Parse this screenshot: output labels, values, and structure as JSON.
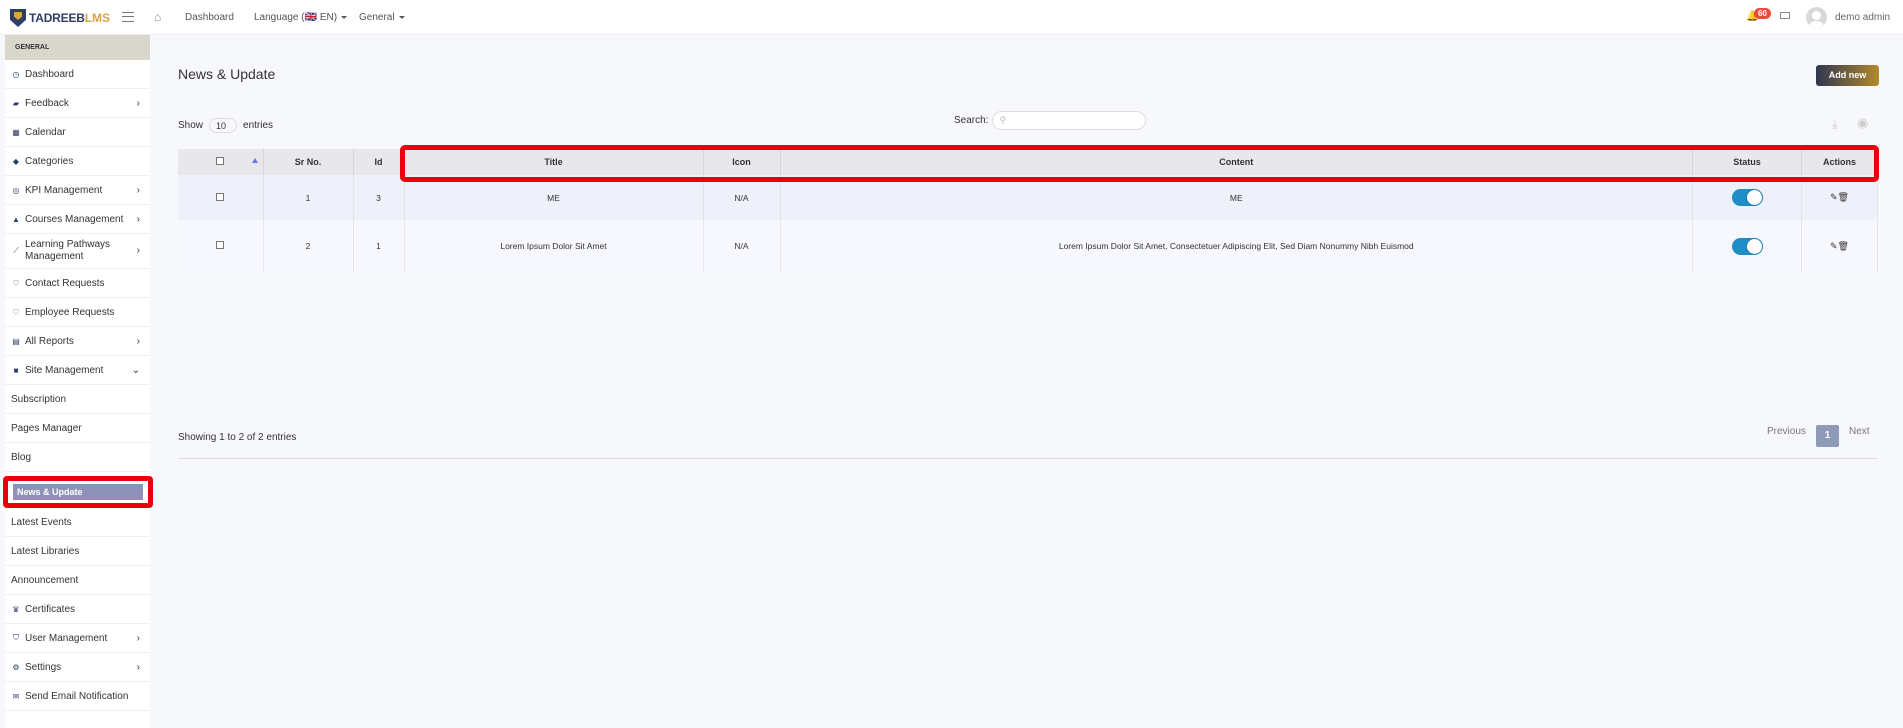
{
  "brand": {
    "part1": "TADREEB",
    "part2": "LMS"
  },
  "topbar": {
    "dashboard": "Dashboard",
    "language": "Language (🇬🇧 EN)",
    "general": "General",
    "notifications_count": "60",
    "user": "demo admin"
  },
  "sidebar": {
    "section": "GENERAL",
    "items": [
      {
        "label": "Dashboard",
        "icon": "dashboard-icon",
        "chevron": ""
      },
      {
        "label": "Feedback",
        "icon": "comments-icon",
        "chevron": "›"
      },
      {
        "label": "Calendar",
        "icon": "calendar-icon",
        "chevron": ""
      },
      {
        "label": "Categories",
        "icon": "tags-icon",
        "chevron": ""
      },
      {
        "label": "KPI Management",
        "icon": "target-icon",
        "chevron": "›"
      },
      {
        "label": "Courses Management",
        "icon": "graduation-cap-icon",
        "chevron": "›"
      },
      {
        "label": "Learning Pathways Management",
        "icon": "pathway-icon",
        "chevron": "›"
      },
      {
        "label": "Contact Requests",
        "icon": "contact-icon",
        "chevron": ""
      },
      {
        "label": "Employee Requests",
        "icon": "employee-icon",
        "chevron": ""
      },
      {
        "label": "All Reports",
        "icon": "chart-icon",
        "chevron": "›"
      },
      {
        "label": "Site Management",
        "icon": "folder-icon",
        "chevron": "⌄"
      },
      {
        "label": "Subscription"
      },
      {
        "label": "Pages Manager"
      },
      {
        "label": "Blog"
      },
      {
        "label": "News & Update"
      },
      {
        "label": "Latest Events"
      },
      {
        "label": "Latest Libraries"
      },
      {
        "label": "Announcement"
      },
      {
        "label": "Certificates",
        "icon": "trophy-icon",
        "chevron": ""
      },
      {
        "label": "User Management",
        "icon": "shield-icon",
        "chevron": "›"
      },
      {
        "label": "Settings",
        "icon": "gear-icon",
        "chevron": "›"
      },
      {
        "label": "Send Email Notification",
        "icon": "envelope-icon",
        "chevron": ""
      }
    ]
  },
  "main": {
    "title": "News & Update",
    "add_new": "Add new",
    "show": "Show",
    "entries_value": "10",
    "entries": "entries",
    "search_label": "Search:",
    "search_placeholder": "",
    "columns": [
      "Sr No.",
      "Id",
      "Title",
      "Icon",
      "Content",
      "Status",
      "Actions"
    ],
    "rows": [
      {
        "sr": "1",
        "id": "3",
        "title": "ME",
        "icon": "N/A",
        "content": "ME",
        "status": true
      },
      {
        "sr": "2",
        "id": "1",
        "title": "Lorem Ipsum Dolor Sit Amet",
        "icon": "N/A",
        "content": "Lorem Ipsum Dolor Sit Amet, Consectetuer Adipiscing Elit, Sed Diam Nonummy Nibh Euismod",
        "status": true
      }
    ],
    "info": "Showing 1 to 2 of 2 entries",
    "previous": "Previous",
    "current_page": "1",
    "next": "Next"
  }
}
